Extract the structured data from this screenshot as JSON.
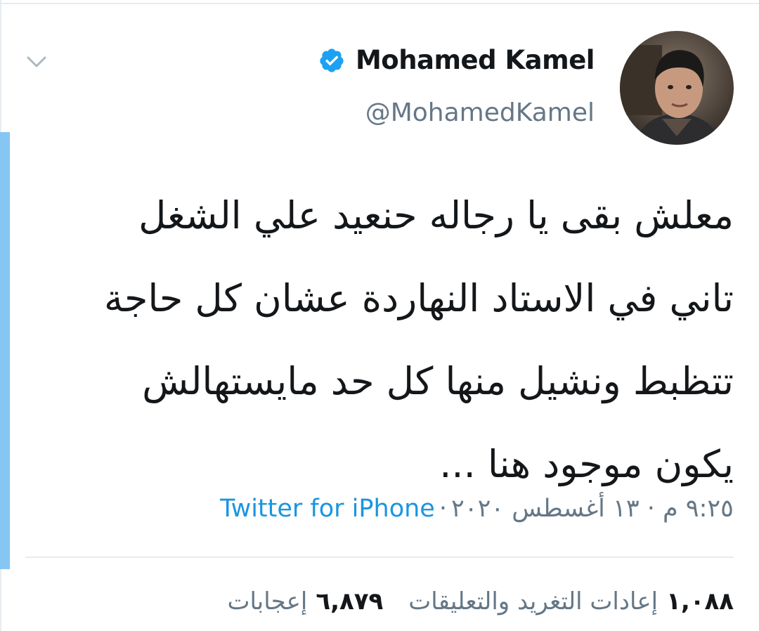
{
  "tweet": {
    "author": {
      "display_name": "Mohamed Kamel",
      "handle": "@MohamedKamel",
      "verified": true
    },
    "text_lines": [
      "معلش بقى يا رجاله حنعيد علي الشغل",
      "تاني في الاستاد النهاردة عشان كل حاجة",
      "تتظبط ونشيل منها كل حد مايستهالش",
      "يكون موجود هنا ..."
    ],
    "timestamp": "٩:٢٥ م · ١٣ أغسطس ٢٠٢٠",
    "source_separator": "·",
    "source": "Twitter for iPhone",
    "stats": {
      "retweets_count": "١,٠٨٨",
      "retweets_label": "إعادات التغريد والتعليقات",
      "likes_count": "٦,٨٧٩",
      "likes_label": "إعجابات"
    }
  },
  "icons": {
    "menu": "chevron-down-icon",
    "verified": "verified-badge-icon"
  },
  "colors": {
    "text_primary": "#14171a",
    "text_secondary": "#657786",
    "link": "#1b95e0",
    "verified_badge": "#1da1f2",
    "focus_bar": "#86c6f3",
    "divider": "#e6ecf0"
  }
}
